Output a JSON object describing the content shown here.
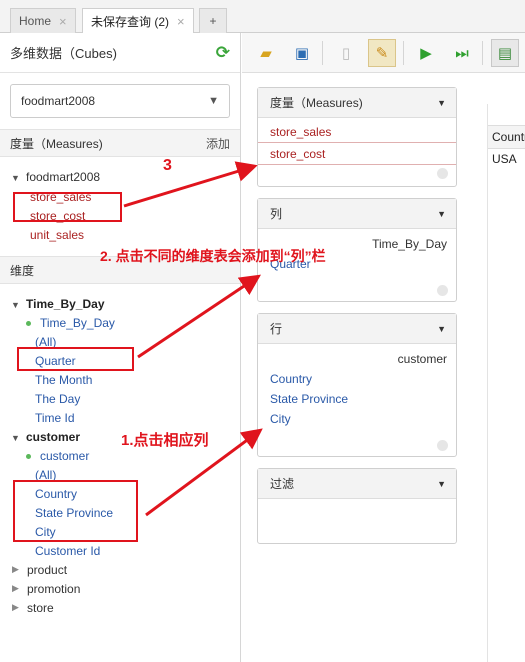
{
  "tabs": [
    {
      "label": "Home",
      "active": false
    },
    {
      "label": "未保存查询 (2)",
      "active": true
    },
    {
      "label": "+",
      "active": false
    }
  ],
  "left_panel": {
    "title": "多维数据（Cubes)",
    "cube_select": "foodmart2008",
    "measures_header": "度量（Measures)",
    "add_label": "添加",
    "measures_group": "foodmart2008",
    "measures": [
      "store_sales",
      "store_cost",
      "unit_sales"
    ],
    "dimensions_header": "维度",
    "dimensions": {
      "time_by_day": {
        "label": "Time_By_Day",
        "hierarchy": "Time_By_Day",
        "levels": [
          "(All)",
          "Quarter",
          "The Month",
          "The Day",
          "Time Id"
        ]
      },
      "customer": {
        "label": "customer",
        "hierarchy": "customer",
        "levels": [
          "(All)",
          "Country",
          "State Province",
          "City",
          "Customer Id"
        ]
      },
      "collapsed": [
        "product",
        "promotion",
        "store"
      ]
    }
  },
  "drop_zones": {
    "measures": {
      "title": "度量（Measures)",
      "items": [
        "store_sales",
        "store_cost"
      ]
    },
    "columns": {
      "title": "列",
      "hierarchy": "Time_By_Day",
      "items": [
        "Quarter"
      ]
    },
    "rows": {
      "title": "行",
      "hierarchy": "customer",
      "items": [
        "Country",
        "State Province",
        "City"
      ]
    },
    "filter": {
      "title": "过滤"
    }
  },
  "result": {
    "header": "Country",
    "cell": "USA"
  },
  "annotations": {
    "step1": "1.点击相应列",
    "step2": "2. 点击不同的维度表会添加到“列”栏",
    "step3": "3"
  },
  "colors": {
    "accent_red": "#e0141d",
    "measure_red": "#a22222",
    "level_blue": "#2a59a8"
  }
}
